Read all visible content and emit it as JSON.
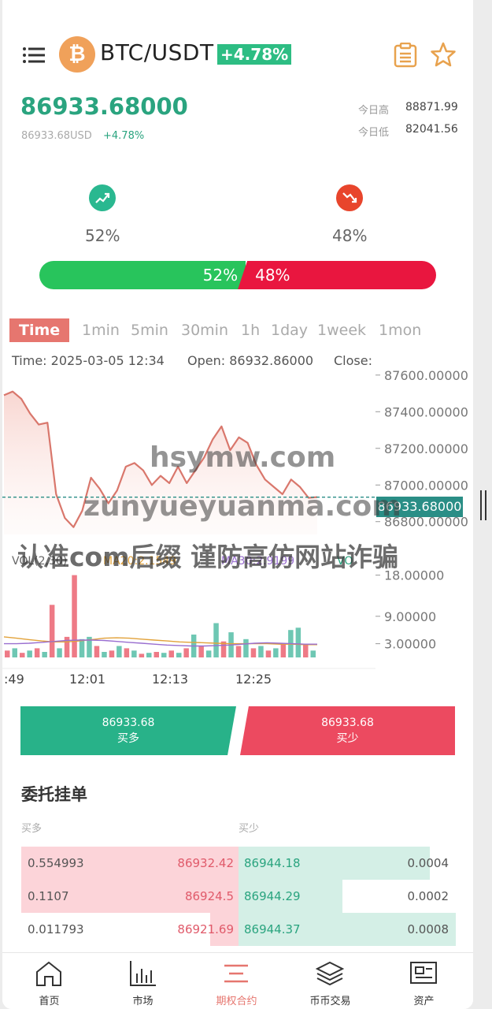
{
  "header": {
    "pair": "BTC/USDT",
    "change_badge": "+4.78%",
    "coin_symbol": "₿"
  },
  "ticker": {
    "last_price": "86933.68000",
    "price_usd": "86933.68USD",
    "price_usd_change": "+4.78%",
    "high_label": "今日高",
    "high_value": "88871.99",
    "low_label": "今日低",
    "low_value": "82041.56"
  },
  "sentiment": {
    "up_pct": "52%",
    "down_pct": "48%",
    "up_fraction": 0.52,
    "up_color": "#28c45c",
    "down_color": "#e9163f",
    "up_icon_color": "#2ab890",
    "down_icon_color": "#e8452c"
  },
  "timeframes": [
    "Time",
    "1min",
    "5min",
    "30min",
    "1h",
    "1day",
    "1week",
    "1mon"
  ],
  "active_timeframe": "Time",
  "info": {
    "time": "Time: 2025-03-05 12:34",
    "open": "Open: 86932.86000",
    "close": "Close:"
  },
  "chart_data": {
    "type": "line",
    "price_axis": [
      "87600.00000",
      "87400.00000",
      "87200.00000",
      "87000.00000",
      "86800.00000"
    ],
    "price_ylim": [
      86730,
      87625
    ],
    "current_price_tag": "86933.68000",
    "price_series": [
      87490,
      87510,
      87470,
      87390,
      87330,
      87340,
      86950,
      86820,
      86770,
      86860,
      87040,
      86980,
      86900,
      86970,
      87100,
      87120,
      87080,
      87000,
      87050,
      87010,
      87100,
      87010,
      87080,
      87150,
      87250,
      87320,
      87190,
      87260,
      87230,
      87110,
      87030,
      86990,
      86950,
      87030,
      86990,
      86930,
      86934
    ],
    "volume_legend": {
      "vol": "VOL(2,30)",
      "ma20": "MA20:2.1549",
      "ma30": "MA30:2.9199",
      "vol_suffix": "VO"
    },
    "volume_axis": [
      "18.00000",
      "9.00000",
      "3.00000"
    ],
    "volume_ylim": [
      0,
      20
    ],
    "volumes": [
      {
        "v": 1.5,
        "up": false
      },
      {
        "v": 2.0,
        "up": true
      },
      {
        "v": 1.0,
        "up": false
      },
      {
        "v": 1.5,
        "up": true
      },
      {
        "v": 2.0,
        "up": false
      },
      {
        "v": 1.2,
        "up": true
      },
      {
        "v": 11.5,
        "up": false
      },
      {
        "v": 2.0,
        "up": true
      },
      {
        "v": 4.5,
        "up": false
      },
      {
        "v": 18.0,
        "up": false
      },
      {
        "v": 4.0,
        "up": true
      },
      {
        "v": 4.5,
        "up": true
      },
      {
        "v": 2.5,
        "up": false
      },
      {
        "v": 1.2,
        "up": true
      },
      {
        "v": 1.5,
        "up": false
      },
      {
        "v": 2.5,
        "up": true
      },
      {
        "v": 2.0,
        "up": false
      },
      {
        "v": 1.5,
        "up": true
      },
      {
        "v": 0.8,
        "up": false
      },
      {
        "v": 1.0,
        "up": true
      },
      {
        "v": 1.2,
        "up": false
      },
      {
        "v": 1.0,
        "up": true
      },
      {
        "v": 1.5,
        "up": false
      },
      {
        "v": 1.0,
        "up": true
      },
      {
        "v": 2.0,
        "up": false
      },
      {
        "v": 5.0,
        "up": true
      },
      {
        "v": 2.5,
        "up": false
      },
      {
        "v": 1.5,
        "up": true
      },
      {
        "v": 7.5,
        "up": true
      },
      {
        "v": 3.5,
        "up": false
      },
      {
        "v": 5.5,
        "up": true
      },
      {
        "v": 2.5,
        "up": false
      },
      {
        "v": 4.0,
        "up": true
      },
      {
        "v": 2.0,
        "up": false
      },
      {
        "v": 2.5,
        "up": true
      },
      {
        "v": 1.5,
        "up": false
      },
      {
        "v": 2.0,
        "up": true
      },
      {
        "v": 3.0,
        "up": false
      },
      {
        "v": 6.0,
        "up": true
      },
      {
        "v": 6.5,
        "up": true
      },
      {
        "v": 3.0,
        "up": false
      },
      {
        "v": 1.5,
        "up": true
      }
    ],
    "ma20_series": [
      4.5,
      4.2,
      3.9,
      3.6,
      3.4,
      3.4,
      3.6,
      3.9,
      4.2,
      4.3,
      4.2,
      4.0,
      3.8,
      3.6,
      3.4,
      3.3,
      3.2,
      3.1,
      3.0,
      3.0,
      3.0,
      3.0,
      2.9,
      2.9,
      2.8,
      2.8
    ],
    "ma30_series": [
      3.0,
      3.0,
      3.1,
      3.3,
      3.5,
      3.7,
      3.8,
      3.8,
      3.7,
      3.5,
      3.3,
      3.1,
      2.9,
      2.7,
      2.6,
      2.5,
      2.5,
      2.6,
      2.7,
      2.9,
      3.1,
      3.2,
      3.1,
      3.0,
      2.9,
      2.9
    ],
    "x_ticks": [
      ":49",
      "12:01",
      "12:13",
      "12:25"
    ]
  },
  "actions": {
    "buy_price": "86933.68",
    "buy_label": "买多",
    "sell_price": "86933.68",
    "sell_label": "买少",
    "buy_color": "#28b289",
    "sell_color": "#ec4a60"
  },
  "orderbook": {
    "title": "委托挂单",
    "bid_header": "买多",
    "ask_header": "买少",
    "rows": [
      {
        "bid_qty": "0.554993",
        "bid_price": "86932.42",
        "ask_price": "86944.18",
        "ask_qty": "0.0004",
        "bid_depth": 1.0,
        "ask_depth": 0.88
      },
      {
        "bid_qty": "0.1107",
        "bid_price": "86924.5",
        "ask_price": "86944.29",
        "ask_qty": "0.0002",
        "bid_depth": 1.0,
        "ask_depth": 0.48
      },
      {
        "bid_qty": "0.011793",
        "bid_price": "86921.69",
        "ask_price": "86944.37",
        "ask_qty": "0.0008",
        "bid_depth": 0.13,
        "ask_depth": 1.0
      }
    ]
  },
  "tabs": [
    {
      "label": "首页",
      "icon": "home-icon",
      "active": false
    },
    {
      "label": "市场",
      "icon": "bar-chart-icon",
      "active": false
    },
    {
      "label": "期权合约",
      "icon": "contract-icon",
      "active": true
    },
    {
      "label": "币币交易",
      "icon": "layers-icon",
      "active": false
    },
    {
      "label": "资产",
      "icon": "assets-icon",
      "active": false
    }
  ],
  "watermarks": [
    "hsymw.com",
    "zunyueyuanma.com",
    "认准com后缀 谨防高仿网站诈骗"
  ]
}
